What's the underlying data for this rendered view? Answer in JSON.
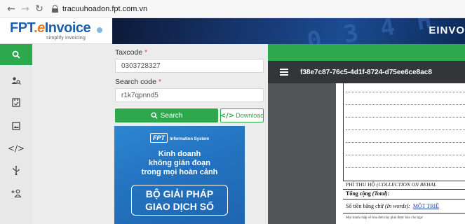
{
  "browser": {
    "back_icon": "arrow-left-icon",
    "forward_icon": "arrow-right-icon",
    "reload_icon": "reload-icon",
    "url": "tracuuhoadon.fpt.com.vn"
  },
  "header": {
    "logo_fpt": "FPT",
    "logo_dot": ".",
    "logo_e": "e",
    "logo_invoice": "Invoice",
    "logo_tagline": "simplify invoicing",
    "banner_digits": "0 3 4 H F",
    "banner_title": "EINVO"
  },
  "rail": {
    "items": [
      {
        "icon": "search-icon",
        "glyph": "⚲"
      },
      {
        "icon": "user-search-icon",
        "glyph": "☺"
      },
      {
        "icon": "document-check-icon",
        "glyph": "☑"
      },
      {
        "icon": "image-icon",
        "glyph": "▣"
      },
      {
        "icon": "code-icon",
        "glyph": "</>"
      },
      {
        "icon": "usb-icon",
        "glyph": "Ψ"
      },
      {
        "icon": "add-user-icon",
        "glyph": "+☺"
      }
    ]
  },
  "form": {
    "taxcode_label": "Taxcode",
    "taxcode_required": "*",
    "taxcode_value": "0303728327",
    "searchcode_label": "Search code",
    "searchcode_required": "*",
    "searchcode_value": "r1k7qpnnd5",
    "search_button": "Search",
    "download_button": "Download",
    "search_icon": "search-icon",
    "download_icon": "code-icon"
  },
  "ad": {
    "brand": "FPT",
    "brand_sub": "Information System",
    "line1": "Kinh doanh",
    "line2": "không gián đoạn",
    "line3": "trong mọi hoàn cảnh",
    "box_line1": "BỘ GIẢI PHÁP",
    "box_line2": "GIAO DỊCH SỐ"
  },
  "viewer": {
    "menu_icon": "hamburger-icon",
    "doc_id": "f38e7c87-76c5-4d1f-8724-d75ee6ce8ac8",
    "fee_label": "PHÍ THU HỘ",
    "fee_label_en": "(COLLECTION ON BEHAL",
    "total_label": "Tổng cộng",
    "total_label_en": "(Total):",
    "words_label": "Số tiền bằng chữ",
    "words_label_en": "(In words):",
    "words_value": "MỘT TRIỆ",
    "note": "Mọi tranh chấp về hóa đơn này phải được báo cho ngư"
  },
  "colors": {
    "accent_green": "#2ba94c",
    "brand_blue": "#1c5fad",
    "brand_orange": "#ee7a1e"
  }
}
